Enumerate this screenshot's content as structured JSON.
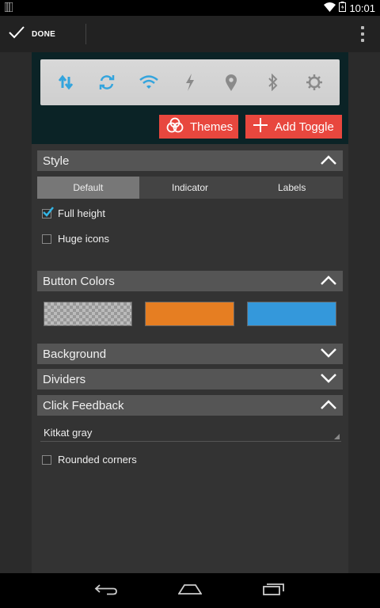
{
  "status_bar": {
    "time": "10:01"
  },
  "action_bar": {
    "done_label": "DONE"
  },
  "toggles": [
    "sync-data-icon",
    "autorotate-icon",
    "wifi-icon",
    "flash-icon",
    "location-icon",
    "bluetooth-icon",
    "brightness-icon"
  ],
  "preview_actions": {
    "themes_label": "Themes",
    "add_toggle_label": "Add Toggle"
  },
  "style_section": {
    "title": "Style",
    "tabs": [
      "Default",
      "Indicator",
      "Labels"
    ],
    "selected_tab": "Default",
    "options": [
      {
        "label": "Full height",
        "checked": true
      },
      {
        "label": "Huge icons",
        "checked": false
      }
    ]
  },
  "button_colors_section": {
    "title": "Button Colors",
    "swatches": [
      "transparent",
      "#e67e22",
      "#3498db"
    ]
  },
  "background_section": {
    "title": "Background"
  },
  "dividers_section": {
    "title": "Dividers"
  },
  "click_feedback_section": {
    "title": "Click Feedback",
    "selected_value": "Kitkat gray",
    "options": [
      {
        "label": "Rounded corners",
        "checked": false
      }
    ]
  },
  "colors": {
    "accent_red": "#e8473e",
    "toggle_blue": "#33a4dd",
    "toggle_gray": "#8a8a8a"
  }
}
